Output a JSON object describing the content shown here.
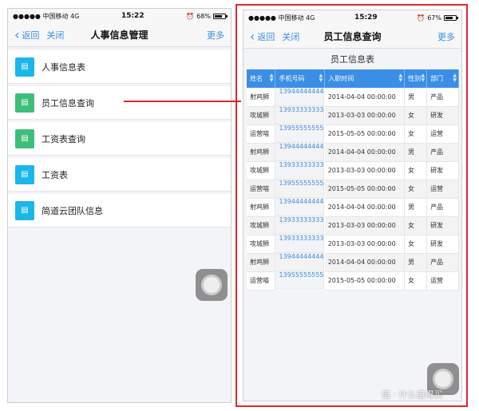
{
  "left": {
    "status": {
      "carrier": "●●●●● 中国移动 4G",
      "time": "15:22",
      "battery": "68%"
    },
    "nav": {
      "back": "返回",
      "close": "关闭",
      "title": "人事信息管理",
      "more": "更多"
    },
    "menu": [
      {
        "label": "人事信息表",
        "color": "#1ab7ea"
      },
      {
        "label": "员工信息查询",
        "color": "#3dbf7a"
      },
      {
        "label": "工资表查询",
        "color": "#3dbf7a"
      },
      {
        "label": "工资表",
        "color": "#1ab7ea"
      },
      {
        "label": "简道云团队信息",
        "color": "#1ab7ea"
      }
    ]
  },
  "right": {
    "status": {
      "carrier": "●●●●● 中国移动 4G",
      "time": "15:29",
      "battery": "67%"
    },
    "nav": {
      "back": "返回",
      "close": "关闭",
      "title": "员工信息查询",
      "more": "更多"
    },
    "section_title": "员工信息表",
    "columns": [
      "姓名",
      "手机号码",
      "入职时间",
      "性别",
      "部门"
    ],
    "rows": [
      [
        "射鸡狮",
        "13944444444",
        "2014-04-04 00:00:00",
        "男",
        "产品"
      ],
      [
        "攻城狮",
        "13933333333",
        "2013-03-03 00:00:00",
        "女",
        "研发"
      ],
      [
        "运营喵",
        "13955555555",
        "2015-05-05 00:00:00",
        "女",
        "运营"
      ],
      [
        "射鸡狮",
        "13944444444",
        "2014-04-04 00:00:00",
        "男",
        "产品"
      ],
      [
        "攻城狮",
        "13933333333",
        "2013-03-03 00:00:00",
        "女",
        "研发"
      ],
      [
        "运营喵",
        "13955555555",
        "2015-05-05 00:00:00",
        "女",
        "运营"
      ],
      [
        "射鸡狮",
        "13944444444",
        "2014-04-04 00:00:00",
        "男",
        "产品"
      ],
      [
        "攻城狮",
        "13933333333",
        "2013-03-03 00:00:00",
        "女",
        "研发"
      ],
      [
        "攻城狮",
        "13933333333",
        "2013-03-03 00:00:00",
        "女",
        "研发"
      ],
      [
        "射鸡狮",
        "13944444444",
        "2014-04-04 00:00:00",
        "男",
        "产品"
      ],
      [
        "运营喵",
        "13955555555",
        "2015-05-05 00:00:00",
        "女",
        "运营"
      ]
    ]
  },
  "watermark": "值 · 什么值得买",
  "colors": {
    "accent": "#3a8ee6",
    "highlight": "#e4262a"
  }
}
